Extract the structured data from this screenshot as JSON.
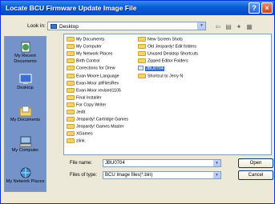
{
  "window": {
    "title": "Locate BCU Firmware Update Image File"
  },
  "titlebar": {
    "help_icon": "?",
    "close_icon": "×"
  },
  "lookin": {
    "label": "Look in:",
    "value": "Desktop"
  },
  "places": [
    {
      "label": "My Recent Documents",
      "icon": "recent-documents-icon"
    },
    {
      "label": "Desktop",
      "icon": "desktop-icon"
    },
    {
      "label": "My Documents",
      "icon": "my-documents-icon"
    },
    {
      "label": "My Computer",
      "icon": "my-computer-icon"
    },
    {
      "label": "My Network Places",
      "icon": "network-places-icon"
    }
  ],
  "files": {
    "col1": [
      "My Documents",
      "My Computer",
      "My Network Places",
      "Birth Control",
      "Corrections for Drew",
      "Evan Moore Language",
      "Evan-Moor allFilesRev",
      "Evan-Moor revised1105",
      "Final Installer",
      "For Copy Writer",
      "Jedit",
      "Jeopardy! Cartridge Games",
      "Jeopardy! Games Master",
      "XGames",
      "zlink"
    ],
    "col2": [
      "New Screen Shots",
      "Old Jeopardy! Edit folders",
      "Unused Desktop Shortcuts",
      "Zipped Editor Folders",
      "JBU0704",
      "Shortcut to Jerry N"
    ],
    "selected": "JBU0704"
  },
  "filename": {
    "label": "File name:",
    "value": "JBU0704"
  },
  "filetype": {
    "label": "Files of type:",
    "value": "BCU Image files(*.bin)"
  },
  "buttons": {
    "open": "Open",
    "cancel": "Cancel"
  }
}
